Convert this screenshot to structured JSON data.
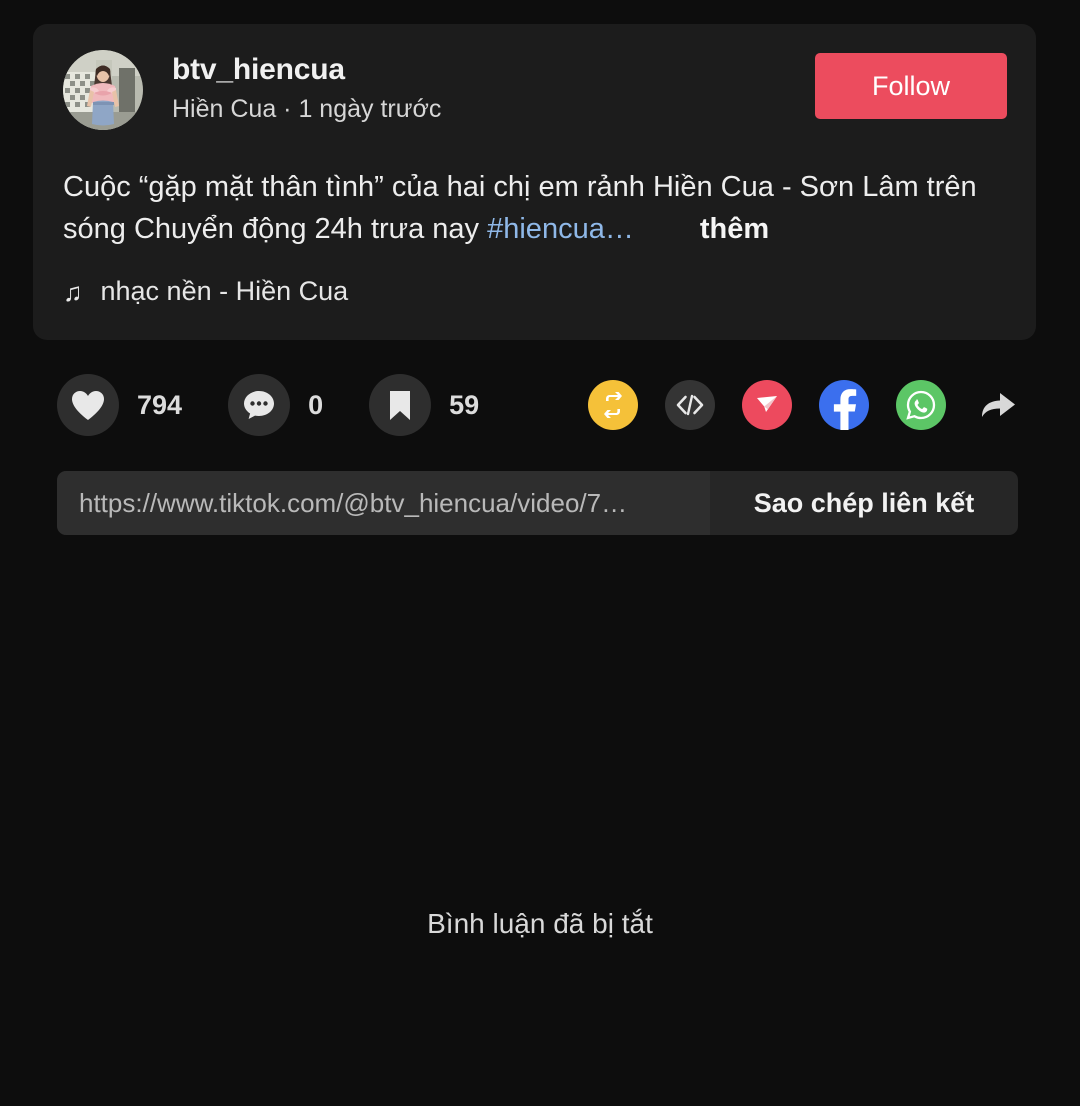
{
  "post": {
    "author": {
      "handle": "btv_hiencua",
      "display_name": "Hiền Cua",
      "separator": "·",
      "timestamp": "1 ngày trước",
      "subline": "Hiền Cua · 1 ngày trước",
      "avatar_alt": "btv_hiencua avatar"
    },
    "follow_label": "Follow",
    "caption": {
      "text": "Cuộc “gặp mặt thân tình” của hai chị em rảnh Hiền Cua - Sơn Lâm trên sóng Chuyển động 24h trưa nay ",
      "hashtag": "#hiencua…",
      "more_label": "thêm"
    },
    "music": {
      "icon": "♫",
      "label": "nhạc nền - Hiền Cua"
    }
  },
  "actions": {
    "like": {
      "icon": "heart-icon",
      "count": "794"
    },
    "comment": {
      "icon": "comment-icon",
      "count": "0"
    },
    "bookmark": {
      "icon": "bookmark-icon",
      "count": "59"
    }
  },
  "share": {
    "items": [
      {
        "name": "repost-icon",
        "label": "Repost",
        "color": "#f5c139"
      },
      {
        "name": "embed-code-icon",
        "label": "Embed",
        "color": "#343434"
      },
      {
        "name": "zalo-icon",
        "label": "Zalo",
        "color": "#ed4a5e"
      },
      {
        "name": "facebook-icon",
        "label": "Facebook",
        "color": "#3b6fee"
      },
      {
        "name": "whatsapp-icon",
        "label": "WhatsApp",
        "color": "#5cc666"
      },
      {
        "name": "share-arrow-icon",
        "label": "Share",
        "color": "#d8d8d8"
      }
    ]
  },
  "copy_link": {
    "url": "https://www.tiktok.com/@btv_hiencua/video/7…",
    "placeholder": "https://www.tiktok.com/@btv_hiencua/video/7…",
    "button_label": "Sao chép liên kết"
  },
  "comments": {
    "disabled_message": "Bình luận đã bị tắt"
  },
  "colors": {
    "page_background": "#0d0d0d",
    "card_background": "#1c1c1c",
    "follow_accent": "#ec4c5e",
    "hashtag": "#8fb8e8",
    "circle_button": "#2e2e2e"
  }
}
